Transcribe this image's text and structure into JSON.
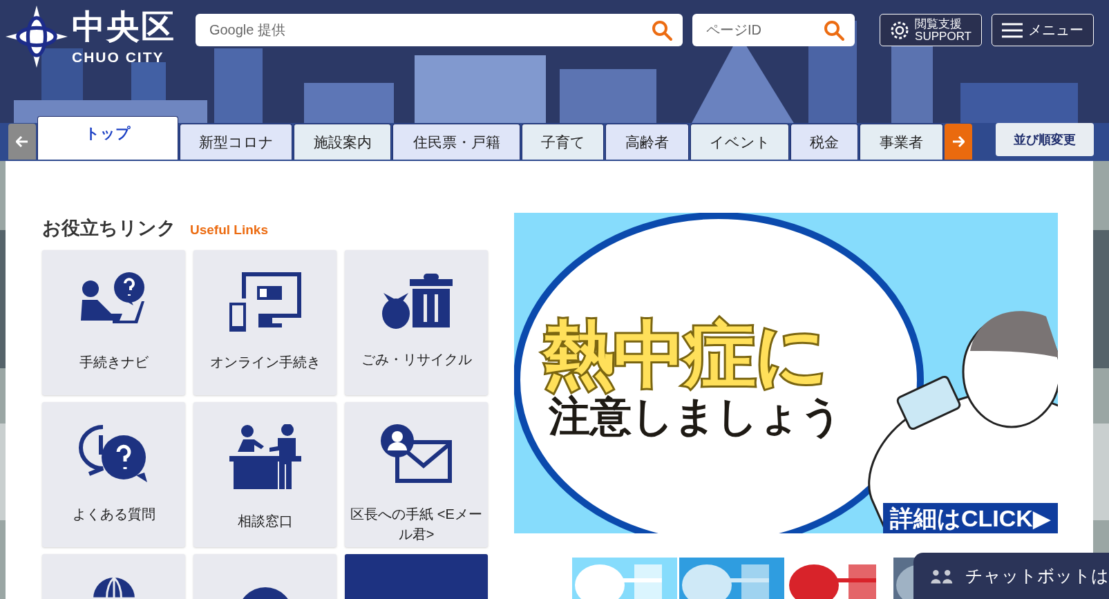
{
  "header": {
    "logo_main": "中央区",
    "logo_sub": "CHUO CITY",
    "search": {
      "placeholder": "Google 提供"
    },
    "page_id": {
      "placeholder": "ページID"
    },
    "support_button": {
      "line1": "閲覧支援",
      "line2": "SUPPORT"
    },
    "menu_button": "メニュー"
  },
  "nav": {
    "tabs": [
      {
        "label": "トップ",
        "selected": true
      },
      {
        "label": "新型コロナ",
        "selected": false
      },
      {
        "label": "施設案内",
        "selected": false
      },
      {
        "label": "住民票・戸籍",
        "selected": false
      },
      {
        "label": "子育て",
        "selected": false
      },
      {
        "label": "高齢者",
        "selected": false
      },
      {
        "label": "イベント",
        "selected": false
      },
      {
        "label": "税金",
        "selected": false
      },
      {
        "label": "事業者",
        "selected": false
      }
    ],
    "sort_button": "並び順変更"
  },
  "useful_links": {
    "title": "お役立ちリンク",
    "subtitle": "Useful Links",
    "tiles": [
      {
        "kind": "plain",
        "label": "手続きナビ"
      },
      {
        "kind": "plain",
        "label": "オンライン手続き"
      },
      {
        "kind": "plain",
        "label": "ごみ・リサイクル"
      },
      {
        "kind": "plain",
        "label": "よくある質問"
      },
      {
        "kind": "plain",
        "label": "相談窓口"
      },
      {
        "kind": "plain",
        "label": "区長への手紙 <Eメール君>"
      },
      {
        "kind": "plain"
      },
      {
        "kind": "plain"
      },
      {
        "kind": "dark"
      }
    ]
  },
  "banner": {
    "headline": "熱中症に",
    "subline": "注意しましょう",
    "cta": "詳細はCLICK▶"
  },
  "chatbot": {
    "label": "チャットボットは"
  }
}
